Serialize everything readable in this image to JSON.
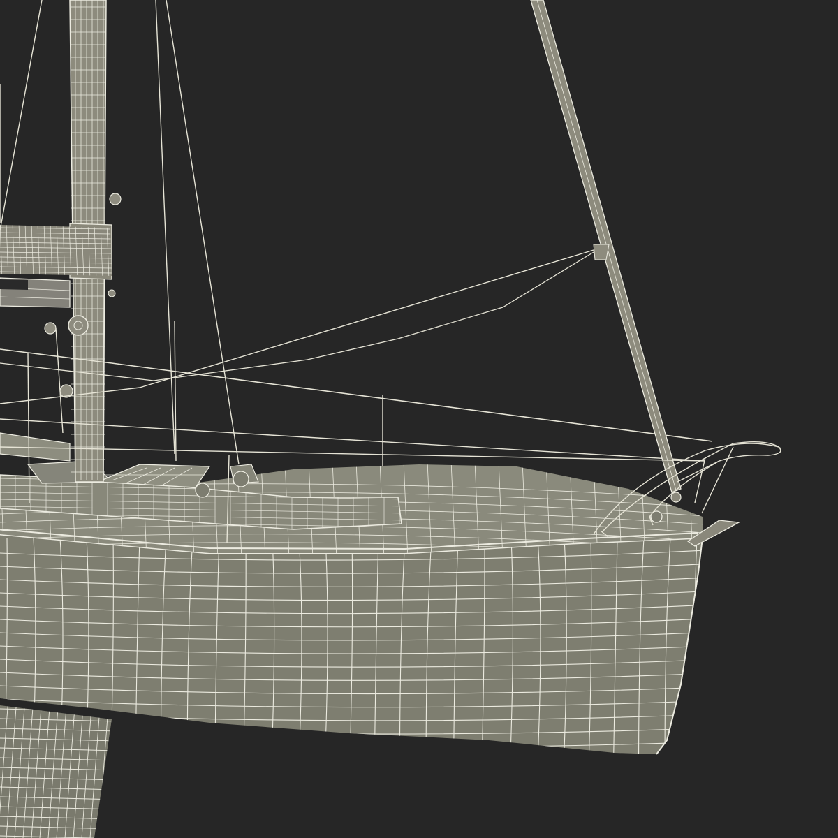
{
  "scene": {
    "subject": "sailboat-wireframe-render",
    "colors": {
      "background": "#262626",
      "hull_fill": "#7e7e70",
      "deck_fill": "#8a8a7c",
      "mast_fill": "#8d8b7d",
      "wire": "#ecebe0",
      "keel_fill": "#7a7a6d"
    },
    "visible_parts": [
      "mast",
      "boom",
      "furled-mainsail",
      "forestay-pole",
      "bow-pulpit",
      "lifelines",
      "deck",
      "cabin-top",
      "cockpit",
      "hull",
      "keel",
      "winches",
      "stanchions"
    ]
  }
}
